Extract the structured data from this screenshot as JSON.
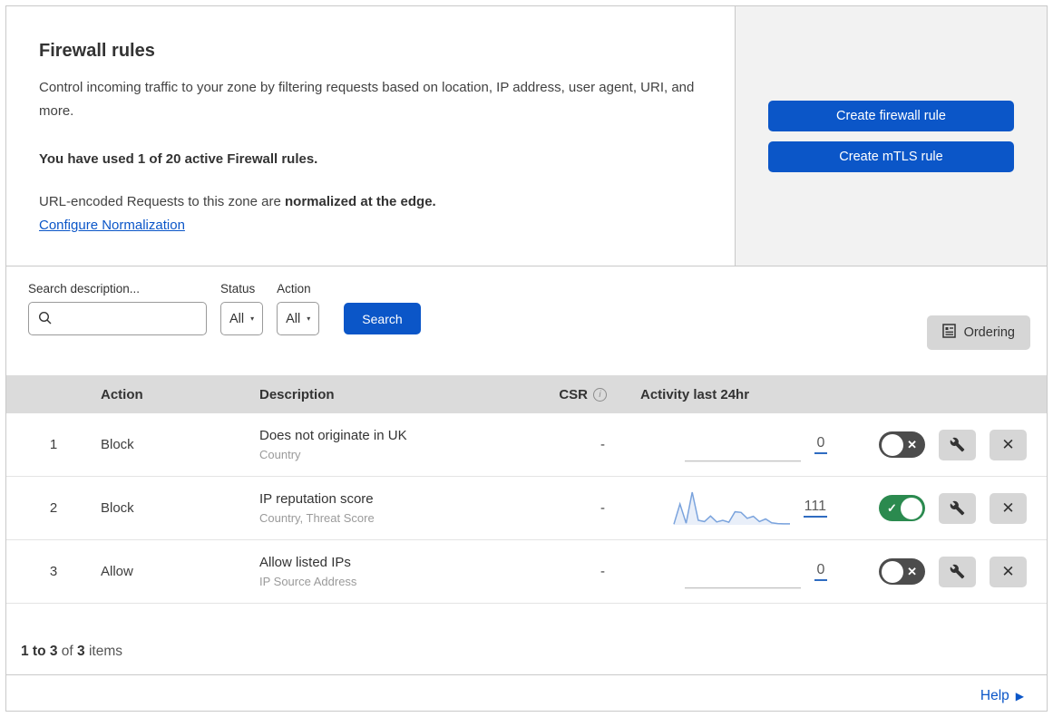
{
  "header": {
    "title": "Firewall rules",
    "description": "Control incoming traffic to your zone by filtering requests based on location, IP address, user agent, URI, and more.",
    "usage_text": "You have used 1 of 20 active Firewall rules.",
    "normalization_prefix": "URL-encoded Requests to this zone are ",
    "normalization_bold": "normalized at the edge.",
    "normalization_link": "Configure Normalization",
    "create_firewall_button": "Create firewall rule",
    "create_mtls_button": "Create mTLS rule"
  },
  "filters": {
    "search_label": "Search description...",
    "search_value": "",
    "status_label": "Status",
    "status_value": "All",
    "action_label": "Action",
    "action_value": "All",
    "search_button": "Search",
    "ordering_button": "Ordering"
  },
  "table": {
    "columns": {
      "action": "Action",
      "description": "Description",
      "csr": "CSR",
      "activity": "Activity last 24hr"
    },
    "rows": [
      {
        "priority": "1",
        "action": "Block",
        "description": "Does not originate in UK",
        "criteria": "Country",
        "csr": "-",
        "activity_count": "0",
        "enabled": false,
        "sparkline": [
          1,
          1
        ],
        "spark_color": "#c6c6c6",
        "spark_fill": "none"
      },
      {
        "priority": "2",
        "action": "Block",
        "description": "IP reputation score",
        "criteria": "Country, Threat Score",
        "csr": "-",
        "activity_count": "111",
        "enabled": true,
        "sparkline": [
          2,
          64,
          5,
          100,
          14,
          10,
          27,
          9,
          14,
          8,
          40,
          38,
          20,
          26,
          10,
          18,
          6,
          4,
          3,
          3
        ],
        "spark_color": "#7aa3dd",
        "spark_fill": "#e9eff9"
      },
      {
        "priority": "3",
        "action": "Allow",
        "description": "Allow listed IPs",
        "criteria": "IP Source Address",
        "csr": "-",
        "activity_count": "0",
        "enabled": false,
        "sparkline": [
          1,
          1
        ],
        "spark_color": "#c6c6c6",
        "spark_fill": "none"
      }
    ],
    "footer": {
      "range": "1 to 3",
      "of": "of",
      "total": "3",
      "items": "items"
    }
  },
  "help": {
    "label": "Help"
  },
  "icons": {
    "info_glyph": "i",
    "dropdown_arrow": "▾",
    "help_arrow": "▶",
    "toggle_off_x": "✕",
    "close_x": "✕",
    "check": "✓",
    "csr_empty": "-"
  },
  "colors": {
    "accent_blue": "#0b56c8",
    "toggle_on_green": "#2b8a4f",
    "toggle_off_gray": "#4c4c4c",
    "spark_blue": "#7aa3dd"
  }
}
